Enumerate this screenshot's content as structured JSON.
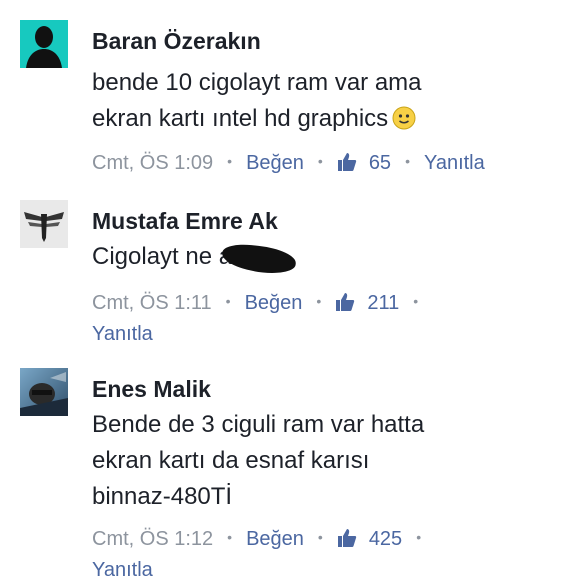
{
  "comments": [
    {
      "author": "Baran Özerakın",
      "avatar_icon": "silhouette-avatar",
      "text_lines": [
        "bende 10 cigolayt ram var ama",
        "ekran kartı ıntel hd graphics"
      ],
      "emoji": "slightly-smiling-emoji",
      "time": "Cmt, ÖS 1:09",
      "like_label": "Beğen",
      "like_count": "65",
      "reply_label": "Yanıtla"
    },
    {
      "author": "Mustafa Emre Ak",
      "avatar_icon": "firefly-logo-avatar",
      "text_lines": [
        "Cigolayt ne a"
      ],
      "time": "Cmt, ÖS 1:11",
      "like_label": "Beğen",
      "like_count": "211",
      "reply_label": "Yanıtla"
    },
    {
      "author": "Enes Malik",
      "avatar_icon": "photo-avatar",
      "text_lines": [
        "Bende de 3 ciguli ram var hatta",
        "ekran kartı da esnaf karısı",
        "binnaz-480Tİ"
      ],
      "time": "Cmt, ÖS 1:12",
      "like_label": "Beğen",
      "like_count": "425",
      "reply_label": "Yanıtla"
    }
  ],
  "colors": {
    "text": "#1d2129",
    "meta": "#8d949e",
    "link": "#4b67a1",
    "avatar_teal": "#17c9bf"
  }
}
